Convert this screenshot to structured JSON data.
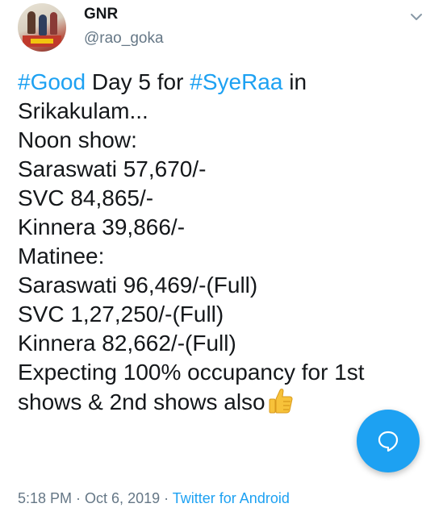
{
  "tweet": {
    "display_name": "GNR",
    "handle": "@rao_goka",
    "body": {
      "line1": {
        "hashtag1": "#Good",
        "text1": " Day 5 for ",
        "hashtag2": "#SyeRaa",
        "text2": " in"
      },
      "line2": "Srikakulam...",
      "line3": "Noon show:",
      "line4": "Saraswati 57,670/-",
      "line5": "SVC 84,865/-",
      "line6": "Kinnera 39,866/-",
      "line7": "Matinee:",
      "line8": "Saraswati 96,469/-(Full)",
      "line9": "SVC 1,27,250/-(Full)",
      "line10": "Kinnera 82,662/-(Full)",
      "line11": "Expecting 100% occupancy for 1st",
      "line12": "shows & 2nd shows also"
    },
    "emoji": "thumbs-up-icon",
    "meta": {
      "time": "5:18 PM",
      "sep1": " · ",
      "date": "Oct 6, 2019",
      "sep2": " · ",
      "source": "Twitter for Android"
    }
  },
  "colors": {
    "hashtag": "#1da1f2",
    "muted": "#657786",
    "fab": "#1da1f2"
  },
  "fab": {
    "icon": "reply-bubble-icon"
  }
}
